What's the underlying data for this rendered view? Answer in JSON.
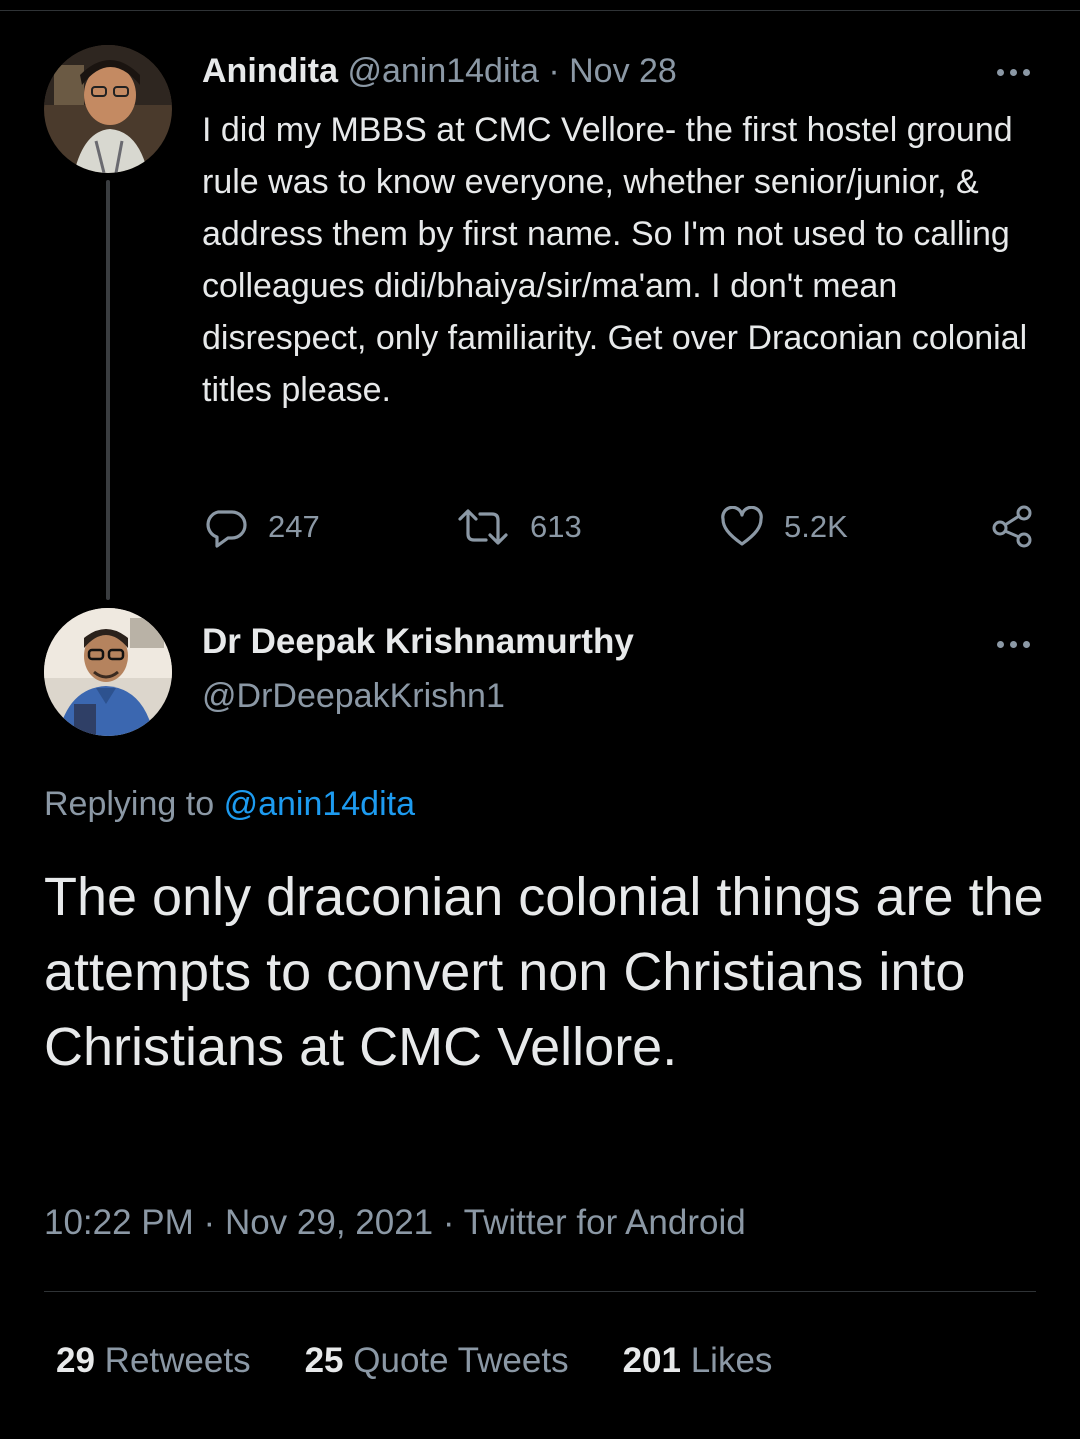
{
  "parent_tweet": {
    "author_name": "Anindita",
    "author_handle": "@anin14dita",
    "date": "Nov 28",
    "separator": "·",
    "text": "I did my MBBS at CMC Vellore- the first hostel ground rule was to know everyone, whether senior/junior, & address them by first name. So I'm not used to calling colleagues didi/bhaiya/sir/ma'am. I don't mean disrespect, only familiarity. Get over Draconian colonial titles please.",
    "replies": "247",
    "retweets": "613",
    "likes": "5.2K"
  },
  "main_tweet": {
    "author_name": "Dr Deepak Krishnamurthy",
    "author_handle": "@DrDeepakKrishn1",
    "replying_label": "Replying to",
    "replying_handle": "@anin14dita",
    "text": "The only draconian colonial things are the attempts to convert non Christians into Christians at CMC Vellore.",
    "time": "10:22 PM",
    "date": "Nov 29, 2021",
    "source": "Twitter for Android",
    "meta_separator": "·",
    "stats": {
      "retweets_count": "29",
      "retweets_label": "Retweets",
      "quotes_count": "25",
      "quotes_label": "Quote Tweets",
      "likes_count": "201",
      "likes_label": "Likes"
    }
  },
  "colors": {
    "background": "#000000",
    "text": "#e7e9ea",
    "muted": "#8b98a5",
    "link": "#1d9bf0",
    "divider": "#2f3336"
  },
  "icons": [
    "reply-icon",
    "retweet-icon",
    "like-icon",
    "share-icon",
    "more-icon"
  ]
}
